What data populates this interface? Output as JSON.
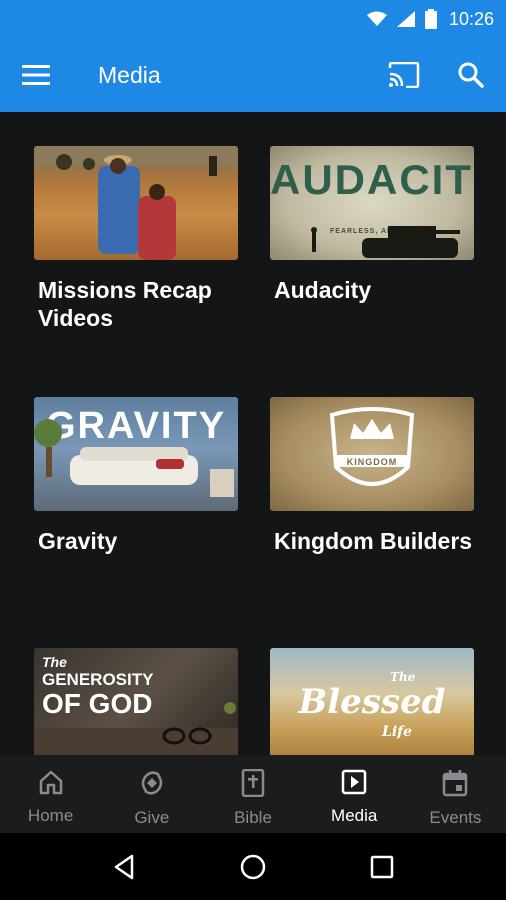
{
  "status_bar": {
    "time": "10:26",
    "icons": [
      "wifi-icon",
      "signal-icon",
      "battery-icon"
    ]
  },
  "app_bar": {
    "title": "Media",
    "icons": [
      "menu-icon",
      "cast-icon",
      "search-icon"
    ]
  },
  "media_items": [
    {
      "label": "Missions Recap Videos",
      "thumb_text": ""
    },
    {
      "label": "Audacity",
      "thumb_text": "AUDACITY",
      "thumb_subtext": "FEARLESS, AND BRAVE"
    },
    {
      "label": "Gravity",
      "thumb_text": "GRAVITY"
    },
    {
      "label": "Kingdom Builders",
      "thumb_text": "KINGDOM"
    },
    {
      "label": "",
      "thumb_text_1": "The",
      "thumb_text_2": "GENEROSITY",
      "thumb_text_3": "OF GOD"
    },
    {
      "label": "",
      "thumb_text_1": "The",
      "thumb_text_2": "Blessed",
      "thumb_text_3": "Life"
    }
  ],
  "bottom_nav": [
    {
      "label": "Home",
      "icon": "home-icon",
      "active": false
    },
    {
      "label": "Give",
      "icon": "give-icon",
      "active": false
    },
    {
      "label": "Bible",
      "icon": "bible-icon",
      "active": false
    },
    {
      "label": "Media",
      "icon": "media-play-icon",
      "active": true
    },
    {
      "label": "Events",
      "icon": "calendar-icon",
      "active": false
    }
  ],
  "system_nav": [
    "back-icon",
    "home-circle-icon",
    "recents-icon"
  ],
  "colors": {
    "accent": "#1e88e5",
    "background": "#141517",
    "nav_background": "#1b1c1e",
    "inactive": "#8a8b8e"
  }
}
